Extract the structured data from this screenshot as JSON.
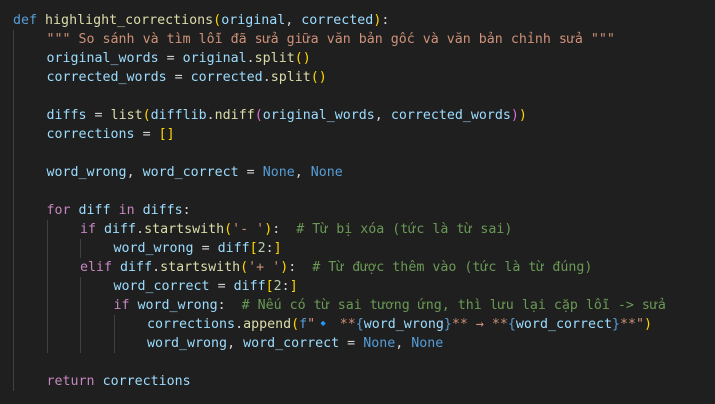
{
  "colors": {
    "background": "#1f1f1f",
    "keyword": "#569cd6",
    "control_keyword": "#c586c0",
    "function": "#dcdcaa",
    "variable": "#9cdcfe",
    "string": "#ce9178",
    "comment": "#6a9955",
    "number": "#b5cea8",
    "operator": "#d4d4d4",
    "bracket_1": "#ffd700",
    "bracket_2": "#da70d6",
    "bracket_3": "#179fff",
    "interpolation": "#569cd6"
  },
  "editor": {
    "language": "python",
    "lines": [
      {
        "indent": 0,
        "tokens": [
          {
            "t": "def",
            "c": "keyword"
          },
          {
            "t": " ",
            "c": "operator"
          },
          {
            "t": "highlight_corrections",
            "c": "function"
          },
          {
            "t": "(",
            "c": "bracket_1"
          },
          {
            "t": "original",
            "c": "variable"
          },
          {
            "t": ", ",
            "c": "operator"
          },
          {
            "t": "corrected",
            "c": "variable"
          },
          {
            "t": ")",
            "c": "bracket_1"
          },
          {
            "t": ":",
            "c": "operator"
          }
        ]
      },
      {
        "indent": 1,
        "tokens": [
          {
            "t": "\"\"\" So sánh và tìm lỗi đã sửa giữa văn bản gốc và văn bản chỉnh sửa \"\"\"",
            "c": "string"
          }
        ]
      },
      {
        "indent": 1,
        "tokens": [
          {
            "t": "original_words",
            "c": "variable"
          },
          {
            "t": " = ",
            "c": "operator"
          },
          {
            "t": "original",
            "c": "variable"
          },
          {
            "t": ".",
            "c": "operator"
          },
          {
            "t": "split",
            "c": "function"
          },
          {
            "t": "()",
            "c": "bracket_1"
          }
        ]
      },
      {
        "indent": 1,
        "tokens": [
          {
            "t": "corrected_words",
            "c": "variable"
          },
          {
            "t": " = ",
            "c": "operator"
          },
          {
            "t": "corrected",
            "c": "variable"
          },
          {
            "t": ".",
            "c": "operator"
          },
          {
            "t": "split",
            "c": "function"
          },
          {
            "t": "()",
            "c": "bracket_1"
          }
        ]
      },
      {
        "indent": 0,
        "tokens": []
      },
      {
        "indent": 1,
        "tokens": [
          {
            "t": "diffs",
            "c": "variable"
          },
          {
            "t": " = ",
            "c": "operator"
          },
          {
            "t": "list",
            "c": "function"
          },
          {
            "t": "(",
            "c": "bracket_1"
          },
          {
            "t": "difflib",
            "c": "variable"
          },
          {
            "t": ".",
            "c": "operator"
          },
          {
            "t": "ndiff",
            "c": "function"
          },
          {
            "t": "(",
            "c": "bracket_2"
          },
          {
            "t": "original_words",
            "c": "variable"
          },
          {
            "t": ", ",
            "c": "operator"
          },
          {
            "t": "corrected_words",
            "c": "variable"
          },
          {
            "t": ")",
            "c": "bracket_2"
          },
          {
            "t": ")",
            "c": "bracket_1"
          }
        ]
      },
      {
        "indent": 1,
        "tokens": [
          {
            "t": "corrections",
            "c": "variable"
          },
          {
            "t": " = ",
            "c": "operator"
          },
          {
            "t": "[]",
            "c": "bracket_1"
          }
        ]
      },
      {
        "indent": 0,
        "tokens": []
      },
      {
        "indent": 1,
        "tokens": [
          {
            "t": "word_wrong",
            "c": "variable"
          },
          {
            "t": ", ",
            "c": "operator"
          },
          {
            "t": "word_correct",
            "c": "variable"
          },
          {
            "t": " = ",
            "c": "operator"
          },
          {
            "t": "None",
            "c": "keyword"
          },
          {
            "t": ", ",
            "c": "operator"
          },
          {
            "t": "None",
            "c": "keyword"
          }
        ]
      },
      {
        "indent": 0,
        "tokens": []
      },
      {
        "indent": 1,
        "tokens": [
          {
            "t": "for",
            "c": "control_keyword"
          },
          {
            "t": " ",
            "c": "operator"
          },
          {
            "t": "diff",
            "c": "variable"
          },
          {
            "t": " ",
            "c": "operator"
          },
          {
            "t": "in",
            "c": "control_keyword"
          },
          {
            "t": " ",
            "c": "operator"
          },
          {
            "t": "diffs",
            "c": "variable"
          },
          {
            "t": ":",
            "c": "operator"
          }
        ]
      },
      {
        "indent": 2,
        "tokens": [
          {
            "t": "if",
            "c": "control_keyword"
          },
          {
            "t": " ",
            "c": "operator"
          },
          {
            "t": "diff",
            "c": "variable"
          },
          {
            "t": ".",
            "c": "operator"
          },
          {
            "t": "startswith",
            "c": "function"
          },
          {
            "t": "(",
            "c": "bracket_1"
          },
          {
            "t": "'- '",
            "c": "string"
          },
          {
            "t": ")",
            "c": "bracket_1"
          },
          {
            "t": ":  ",
            "c": "operator"
          },
          {
            "t": "# Từ bị xóa (tức là từ sai)",
            "c": "comment"
          }
        ]
      },
      {
        "indent": 3,
        "tokens": [
          {
            "t": "word_wrong",
            "c": "variable"
          },
          {
            "t": " = ",
            "c": "operator"
          },
          {
            "t": "diff",
            "c": "variable"
          },
          {
            "t": "[",
            "c": "bracket_1"
          },
          {
            "t": "2",
            "c": "number"
          },
          {
            "t": ":",
            "c": "operator"
          },
          {
            "t": "]",
            "c": "bracket_1"
          }
        ]
      },
      {
        "indent": 2,
        "tokens": [
          {
            "t": "elif",
            "c": "control_keyword"
          },
          {
            "t": " ",
            "c": "operator"
          },
          {
            "t": "diff",
            "c": "variable"
          },
          {
            "t": ".",
            "c": "operator"
          },
          {
            "t": "startswith",
            "c": "function"
          },
          {
            "t": "(",
            "c": "bracket_1"
          },
          {
            "t": "'+ '",
            "c": "string"
          },
          {
            "t": ")",
            "c": "bracket_1"
          },
          {
            "t": ":  ",
            "c": "operator"
          },
          {
            "t": "# Từ được thêm vào (tức là từ đúng)",
            "c": "comment"
          }
        ]
      },
      {
        "indent": 3,
        "tokens": [
          {
            "t": "word_correct",
            "c": "variable"
          },
          {
            "t": " = ",
            "c": "operator"
          },
          {
            "t": "diff",
            "c": "variable"
          },
          {
            "t": "[",
            "c": "bracket_1"
          },
          {
            "t": "2",
            "c": "number"
          },
          {
            "t": ":",
            "c": "operator"
          },
          {
            "t": "]",
            "c": "bracket_1"
          }
        ]
      },
      {
        "indent": 3,
        "tokens": [
          {
            "t": "if",
            "c": "control_keyword"
          },
          {
            "t": " ",
            "c": "operator"
          },
          {
            "t": "word_wrong",
            "c": "variable"
          },
          {
            "t": ":  ",
            "c": "operator"
          },
          {
            "t": "# Nếu có từ sai tương ứng, thì lưu lại cặp lỗi -> sửa",
            "c": "comment"
          }
        ]
      },
      {
        "indent": 4,
        "tokens": [
          {
            "t": "corrections",
            "c": "variable"
          },
          {
            "t": ".",
            "c": "operator"
          },
          {
            "t": "append",
            "c": "function"
          },
          {
            "t": "(",
            "c": "bracket_1"
          },
          {
            "t": "f",
            "c": "keyword"
          },
          {
            "t": "\"",
            "c": "string"
          },
          {
            "t": "🔹",
            "c": "string"
          },
          {
            "t": " **",
            "c": "string"
          },
          {
            "t": "{",
            "c": "interpolation"
          },
          {
            "t": "word_wrong",
            "c": "variable"
          },
          {
            "t": "}",
            "c": "interpolation"
          },
          {
            "t": "** → **",
            "c": "string"
          },
          {
            "t": "{",
            "c": "interpolation"
          },
          {
            "t": "word_correct",
            "c": "variable"
          },
          {
            "t": "}",
            "c": "interpolation"
          },
          {
            "t": "**\"",
            "c": "string"
          },
          {
            "t": ")",
            "c": "bracket_1"
          }
        ]
      },
      {
        "indent": 4,
        "tokens": [
          {
            "t": "word_wrong",
            "c": "variable"
          },
          {
            "t": ", ",
            "c": "operator"
          },
          {
            "t": "word_correct",
            "c": "variable"
          },
          {
            "t": " = ",
            "c": "operator"
          },
          {
            "t": "None",
            "c": "keyword"
          },
          {
            "t": ", ",
            "c": "operator"
          },
          {
            "t": "None",
            "c": "keyword"
          }
        ]
      },
      {
        "indent": 0,
        "tokens": []
      },
      {
        "indent": 1,
        "tokens": [
          {
            "t": "return",
            "c": "control_keyword"
          },
          {
            "t": " ",
            "c": "operator"
          },
          {
            "t": "corrections",
            "c": "variable"
          }
        ]
      }
    ]
  }
}
